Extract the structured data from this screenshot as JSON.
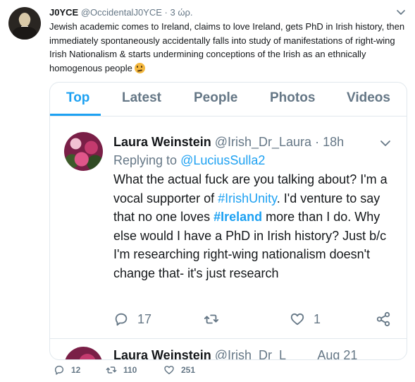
{
  "tweet": {
    "display_name": "J0YCE",
    "handle": "@OccidentalJ0YCE",
    "separator": "·",
    "time": "3 ώρ.",
    "text": "Jewish academic comes to Ireland, claims to love Ireland, gets PhD in Irish history, then immediately spontaneously accidentally falls into study of manifestations of right-wing Irish Nationalism & starts undermining conceptions of the Irish as an ethnically homogenous people",
    "emoji": "thinking-face-emoji",
    "actions": {
      "reply_count": "12",
      "retweet_count": "110",
      "like_count": "251"
    }
  },
  "tabs": [
    {
      "label": "Top",
      "active": true
    },
    {
      "label": "Latest",
      "active": false
    },
    {
      "label": "People",
      "active": false
    },
    {
      "label": "Photos",
      "active": false
    },
    {
      "label": "Videos",
      "active": false
    }
  ],
  "embedded": {
    "display_name": "Laura Weinstein",
    "handle": "@Irish_Dr_Laura",
    "separator": "·",
    "time": "18h",
    "replying_prefix": "Replying to",
    "replying_to": "@LuciusSulla2",
    "text_part1": "What the actual fuck are you talking about? I'm a vocal supporter of",
    "hashtag1": "#IrishUnity",
    "text_part2": ". I'd venture to say that no one loves",
    "hashtag2": "#Ireland",
    "text_part3": "more than I do. Why else would I have a PhD in Irish history? Just b/c I'm researching right-wing nationalism doesn't change that- it's just research",
    "reply_count": "17",
    "like_count": "1",
    "next_preview": {
      "display_name": "Laura Weinstein",
      "handle": "@Irish_Dr_L",
      "time": "Aug 21"
    }
  },
  "colors": {
    "accent": "#1da1f2",
    "muted": "#657786",
    "text": "#14171a",
    "border": "#e1e8ed"
  }
}
